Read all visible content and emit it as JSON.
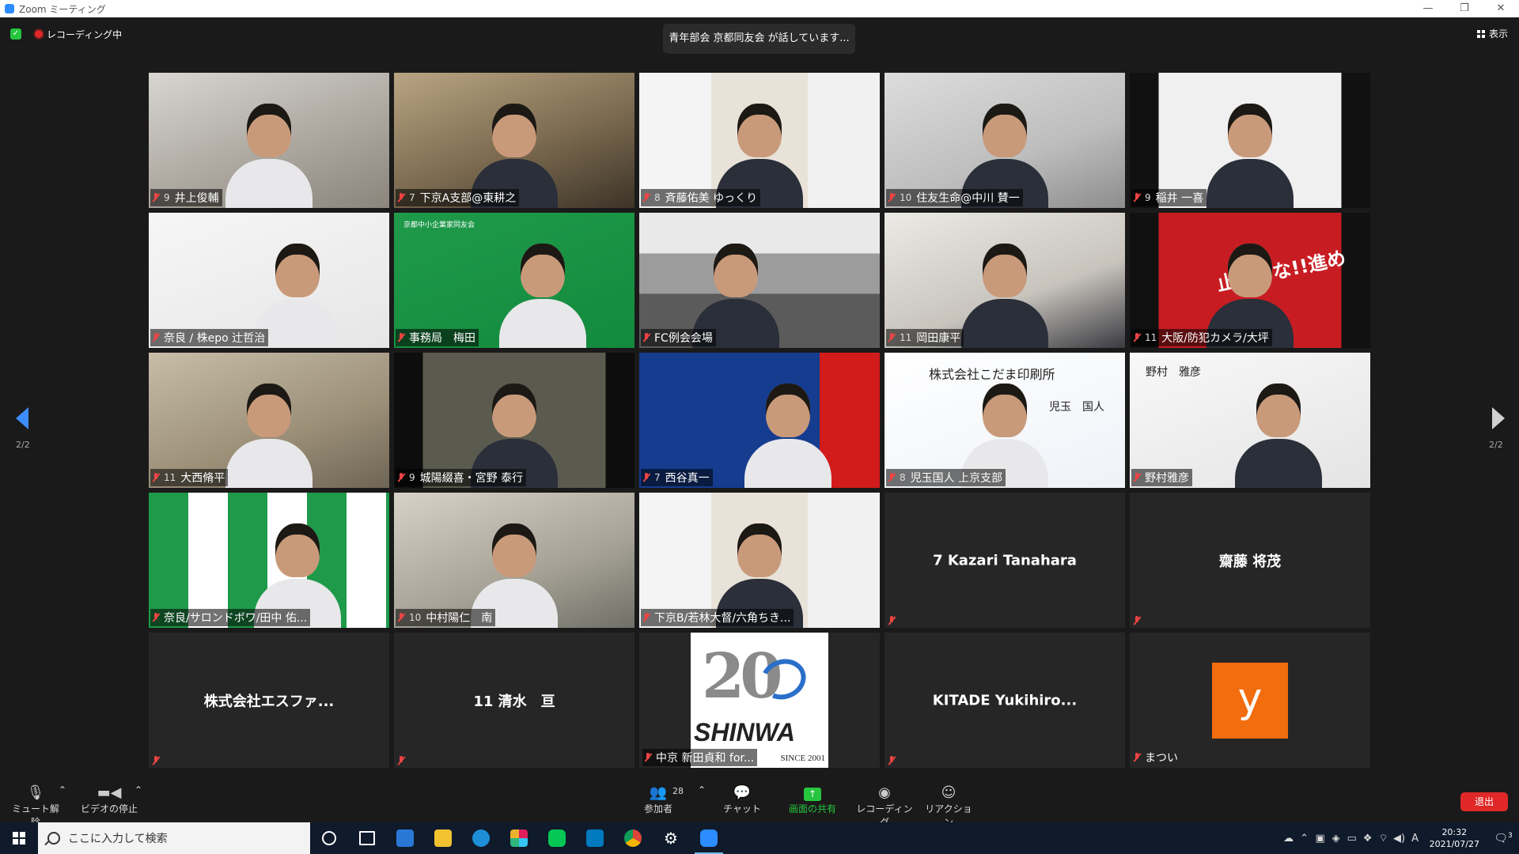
{
  "window": {
    "title": "Zoom ミーティング",
    "controls": [
      "—",
      "❐",
      "✕"
    ]
  },
  "top": {
    "recording_label": "レコーディング中",
    "speaking_label": "青年部会 京都同友会 が話しています...",
    "view_label": "表示"
  },
  "pager": {
    "left": "2/2",
    "right": "2/2"
  },
  "tiles": [
    {
      "num": "9",
      "name": "井上俊輔"
    },
    {
      "num": "7",
      "name": "下京A支部@東耕之"
    },
    {
      "num": "8",
      "name": "斉藤佑美 ゆっくり"
    },
    {
      "num": "10",
      "name": "住友生命@中川 賛一"
    },
    {
      "num": "9",
      "name": "稲井 一喜"
    },
    {
      "num": "",
      "name": "奈良 / 株epo 辻哲治"
    },
    {
      "num": "",
      "name": "事務局　梅田",
      "sign": "京都中小企業家同友会"
    },
    {
      "num": "",
      "name": "FC例会会場"
    },
    {
      "num": "11",
      "name": "岡田康平"
    },
    {
      "num": "11",
      "name": "大阪/防犯カメラ/大坪",
      "sign": "止まるな!!進め"
    },
    {
      "num": "11",
      "name": "大西脩平"
    },
    {
      "num": "9",
      "name": "城陽綴喜・宮野 泰行"
    },
    {
      "num": "7",
      "name": "西谷真一"
    },
    {
      "num": "8",
      "name": "児玉国人 上京支部",
      "sign": "株式会社こだま印刷所",
      "sign2": "児玉　国人"
    },
    {
      "num": "",
      "name": "野村雅彦",
      "sign": "野村　雅彦"
    },
    {
      "num": "",
      "name": "奈良/サロンドボワ/田中 佑..."
    },
    {
      "num": "10",
      "name": "中村陽仁　南"
    },
    {
      "num": "",
      "name": "下京B/若林大督/六角ちき..."
    },
    {
      "num": "",
      "name": "",
      "bigname": "7  Kazari  Tanahara"
    },
    {
      "num": "",
      "name": "",
      "bigname": "齋藤 将茂"
    },
    {
      "num": "",
      "name": "",
      "bigname": "株式会社エスファ..."
    },
    {
      "num": "",
      "name": "",
      "bigname": "11 清水　亘"
    },
    {
      "num": "",
      "name": "中京 新田貞和 for...",
      "logo_num": "20",
      "logo_word": "SHINWA",
      "logo_since": "SINCE 2001"
    },
    {
      "num": "",
      "name": "",
      "bigname": "KITADE  Yukihiro..."
    },
    {
      "num": "",
      "name": "まつい",
      "avatar": "y"
    }
  ],
  "toolbar": {
    "mute": "ミュート解除",
    "video": "ビデオの停止",
    "participants": "参加者",
    "participants_count": "28",
    "chat": "チャット",
    "share": "画面の共有",
    "record": "レコーディング",
    "reactions": "リアクション",
    "leave": "退出"
  },
  "taskbar": {
    "search_placeholder": "ここに入力して検索",
    "time": "20:32",
    "date": "2021/07/27",
    "ime": "A",
    "notifications": "3"
  }
}
